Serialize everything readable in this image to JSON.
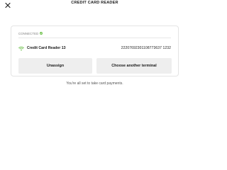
{
  "header": {
    "title": "CREDIT CARD READER",
    "close_icon": "close-icon"
  },
  "card": {
    "status_label": "CONNECTED",
    "status_icon": "check-icon",
    "status_color": "#6cc04a",
    "reader": {
      "icon": "wifi-icon",
      "icon_color": "#6cc04a",
      "name": "Credit Card Reader 13",
      "serial": "22207692301108773637 1232"
    },
    "buttons": {
      "unassign_label": "Unassign",
      "choose_label": "Choose another terminal"
    }
  },
  "footer": {
    "message": "You're all set to take card payments."
  }
}
